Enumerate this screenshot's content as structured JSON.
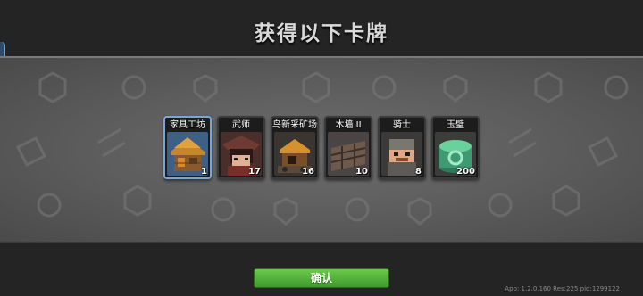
{
  "title": "获得以下卡牌",
  "cards": [
    {
      "name": "家具工坊",
      "count": "1",
      "icon": "furniture-workshop-icon",
      "highlight": true
    },
    {
      "name": "武师",
      "count": "17",
      "icon": "martial-master-icon",
      "highlight": false
    },
    {
      "name": "鸟新采矿场",
      "count": "16",
      "icon": "mine-icon",
      "highlight": false
    },
    {
      "name": "木墙 II",
      "count": "10",
      "icon": "wooden-wall-icon",
      "highlight": false
    },
    {
      "name": "骑士",
      "count": "8",
      "icon": "knight-icon",
      "highlight": false
    },
    {
      "name": "玉璧",
      "count": "200",
      "icon": "jade-disc-icon",
      "highlight": false
    }
  ],
  "confirm_label": "确认",
  "app_info": "App: 1.2.0.160 Res:225 pid:1299122",
  "colors": {
    "confirm_button": "#4fae3a",
    "banner": "#5f5f5f",
    "background": "#242424"
  }
}
